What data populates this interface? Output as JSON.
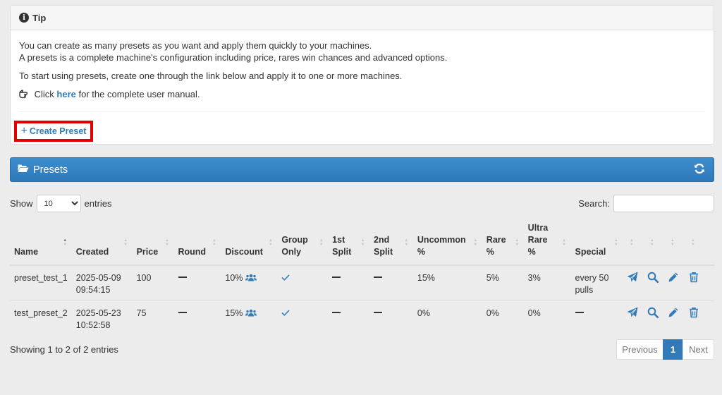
{
  "tip": {
    "title": "Tip",
    "line1": "You can create as many presets as you want and apply them quickly to your machines.",
    "line2": "A presets is a complete machine's configuration including price, rares win chances and advanced options.",
    "line3": "To start using presets, create one through the link below and apply it to one or more machines.",
    "manual_prefix": "Click",
    "manual_link": "here",
    "manual_suffix": "for the complete user manual.",
    "create_button": "Create Preset"
  },
  "panel": {
    "title": "Presets"
  },
  "controls": {
    "show_label": "Show",
    "entries_value": "10",
    "entries_label": "entries",
    "search_label": "Search:"
  },
  "table": {
    "headers": {
      "name": "Name",
      "created": "Created",
      "price": "Price",
      "round": "Round",
      "discount": "Discount",
      "group_only_1": "Group",
      "group_only_2": "Only",
      "first_split_1": "1st",
      "first_split_2": "Split",
      "second_split_1": "2nd",
      "second_split_2": "Split",
      "uncommon_1": "Uncommon",
      "uncommon_2": "%",
      "rare_1": "Rare",
      "rare_2": "%",
      "ultra_1": "Ultra",
      "ultra_2": "Rare",
      "ultra_3": "%",
      "special": "Special"
    },
    "rows": [
      {
        "name": "preset_test_1",
        "created_date": "2025-05-09",
        "created_time": "09:54:15",
        "price": "100",
        "discount": "10%",
        "uncommon": "15%",
        "rare": "5%",
        "ultra": "3%",
        "special_1": "every 50",
        "special_2": "pulls"
      },
      {
        "name": "test_preset_2",
        "created_date": "2025-05-23",
        "created_time": "10:52:58",
        "price": "75",
        "discount": "15%",
        "uncommon": "0%",
        "rare": "0%",
        "ultra": "0%"
      }
    ]
  },
  "footer": {
    "info": "Showing 1 to 2 of 2 entries",
    "previous": "Previous",
    "page": "1",
    "next": "Next"
  },
  "colors": {
    "accent": "#337ab7",
    "highlight_border": "#e00000",
    "header_bar": "#3581c2"
  }
}
